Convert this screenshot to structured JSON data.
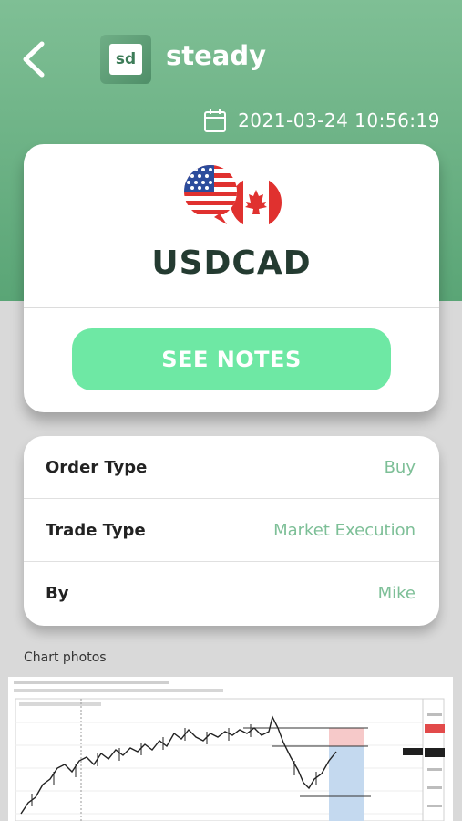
{
  "header": {
    "brand_logo_text": "sd",
    "brand_name": "steady",
    "datetime": "2021-03-24 10:56:19"
  },
  "trade": {
    "pair": "USDCAD",
    "notes_button": "SEE NOTES"
  },
  "details": [
    {
      "label": "Order Type",
      "value": "Buy"
    },
    {
      "label": "Trade Type",
      "value": "Market Execution"
    },
    {
      "label": "By",
      "value": "Mike"
    }
  ],
  "chart": {
    "section_title": "Chart photos"
  },
  "colors": {
    "accent_green": "#6ee8a4",
    "header_green": "#5aa576",
    "value_green": "#7dbf97"
  },
  "icons": [
    "back-chevron-icon",
    "calendar-icon",
    "us-flag-icon",
    "canada-flag-icon"
  ]
}
